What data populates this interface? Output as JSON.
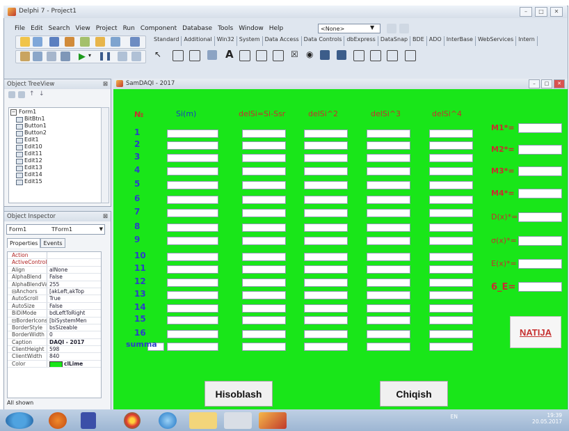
{
  "ide": {
    "title": "Delphi 7 - Project1",
    "menu": [
      "File",
      "Edit",
      "Search",
      "View",
      "Project",
      "Run",
      "Component",
      "Database",
      "Tools",
      "Window",
      "Help"
    ],
    "combo_value": "<None>",
    "palette_tabs": [
      "Standard",
      "Additional",
      "Win32",
      "System",
      "Data Access",
      "Data Controls",
      "dbExpress",
      "DataSnap",
      "BDE",
      "ADO",
      "InterBase",
      "WebServices",
      "Intern"
    ]
  },
  "treeview": {
    "title": "Object TreeView",
    "root": "Form1",
    "items": [
      "BitBtn1",
      "Button1",
      "Button2",
      "Edit1",
      "Edit10",
      "Edit11",
      "Edit12",
      "Edit13",
      "Edit14",
      "Edit15"
    ]
  },
  "inspector": {
    "title": "Object Inspector",
    "object_name": "Form1",
    "object_type": "TForm1",
    "tabs": [
      "Properties",
      "Events"
    ],
    "properties": [
      {
        "k": "Action",
        "v": ""
      },
      {
        "k": "ActiveControl",
        "v": ""
      },
      {
        "k": "Align",
        "v": "alNone"
      },
      {
        "k": "AlphaBlend",
        "v": "False"
      },
      {
        "k": "AlphaBlendVal",
        "v": "255"
      },
      {
        "k": "⊟Anchors",
        "v": "[akLeft,akTop"
      },
      {
        "k": "AutoScroll",
        "v": "True"
      },
      {
        "k": "AutoSize",
        "v": "False"
      },
      {
        "k": "BiDiMode",
        "v": "bdLeftToRight"
      },
      {
        "k": "⊟BorderIcons",
        "v": "[biSystemMen"
      },
      {
        "k": "BorderStyle",
        "v": "bsSizeable"
      },
      {
        "k": "BorderWidth",
        "v": "0"
      },
      {
        "k": "Caption",
        "v": "DAQI - 2017"
      },
      {
        "k": "ClientHeight",
        "v": "598"
      },
      {
        "k": "ClientWidth",
        "v": "840"
      },
      {
        "k": "Color",
        "v": "clLime"
      }
    ],
    "footer": "All shown"
  },
  "form": {
    "title": "SamDAQI - 2017",
    "headers": {
      "num": "№",
      "si": "Si(m)",
      "delsi": "delSi=Si-Ssr",
      "delsi2": "delSi^2",
      "delsi3": "delSi^3",
      "delsi4": "delSi^4"
    },
    "rows": [
      "1",
      "2",
      "3",
      "4",
      "5",
      "6",
      "7",
      "8",
      "9",
      "10",
      "11",
      "12",
      "13",
      "14",
      "15",
      "16"
    ],
    "summa": "summa",
    "results": [
      "M1*=",
      "M2*=",
      "M3*=",
      "M4*=",
      "D(x)*=",
      "σ(x)*=",
      "E(x)*=",
      "6_E="
    ],
    "buttons": {
      "hisoblash": "Hisoblash",
      "chiqish": "Chiqish",
      "natija": "NATIJA"
    }
  },
  "taskbar": {
    "lang": "EN",
    "time": "19:39",
    "date": "20.05.2017"
  }
}
